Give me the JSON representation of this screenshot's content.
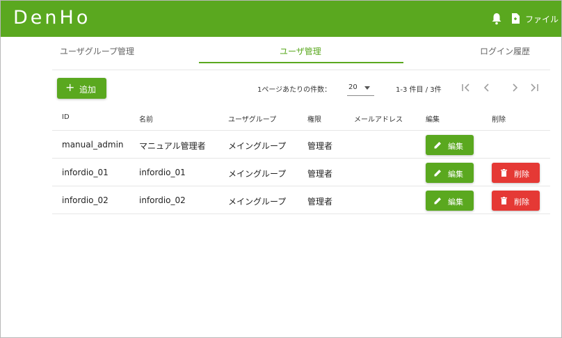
{
  "header": {
    "logo": "DenHo",
    "file_label": "ファイル"
  },
  "tabs": [
    {
      "label": "ユーザグループ管理",
      "active": false
    },
    {
      "label": "ユーザ管理",
      "active": true
    },
    {
      "label": "ログイン履歴",
      "active": false
    }
  ],
  "toolbar": {
    "add_label": "追加",
    "per_page_label": "1ページあたりの件数：",
    "per_page_value": "20",
    "range_label": "1-3 件目 / 3件"
  },
  "table": {
    "columns": [
      "ID",
      "名前",
      "ユーザグループ",
      "権限",
      "メールアドレス",
      "編集",
      "削除"
    ],
    "rows": [
      {
        "id": "manual_admin",
        "name": "マニュアル管理者",
        "group": "メイングループ",
        "role": "管理者",
        "email": "",
        "edit": "編集",
        "delete": null
      },
      {
        "id": "infordio_01",
        "name": "infordio_01",
        "group": "メイングループ",
        "role": "管理者",
        "email": "",
        "edit": "編集",
        "delete": "削除"
      },
      {
        "id": "infordio_02",
        "name": "infordio_02",
        "group": "メイングループ",
        "role": "管理者",
        "email": "",
        "edit": "編集",
        "delete": "削除"
      }
    ]
  },
  "colors": {
    "primary": "#5aa81f",
    "danger": "#e53935"
  }
}
